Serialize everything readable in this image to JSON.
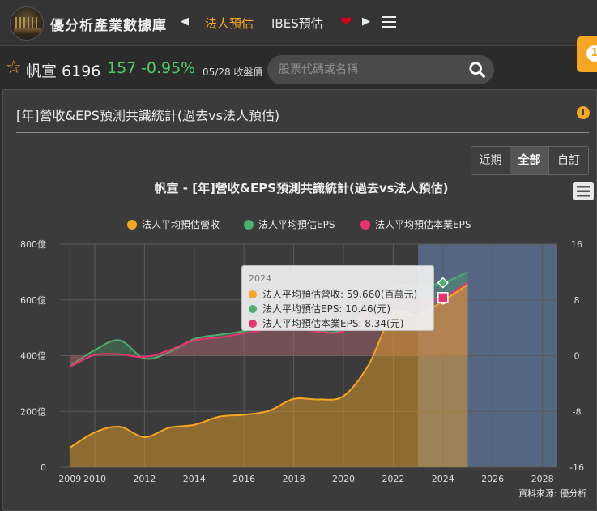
{
  "header": {
    "site_title": "優分析產業數據庫",
    "tabs": [
      {
        "label": "法人預估",
        "active": true
      },
      {
        "label": "IBES預估",
        "active": false
      }
    ],
    "badge": "1"
  },
  "stock": {
    "name_code": "帆宣 6196",
    "price": "157",
    "change": "-0.95%",
    "date_label": "05/28 收盤價",
    "search_placeholder": "股票代碼或名稱"
  },
  "panel": {
    "title": "[年]營收&EPS預測共識統計(過去vs法人預估)",
    "info": "i",
    "range_buttons": [
      {
        "label": "近期",
        "active": false
      },
      {
        "label": "全部",
        "active": true
      },
      {
        "label": "自訂",
        "active": false
      }
    ]
  },
  "colors": {
    "revenue": "#f5a623",
    "eps": "#4caf6e",
    "core_eps": "#e8336f",
    "accent": "#f5a623",
    "forecast_band": "#5a6e8f"
  },
  "chart_data": {
    "type": "area",
    "title": "帆宣 - [年]營收&EPS預測共識統計(過去vs法人預估)",
    "legend_position": "top",
    "x_ticks": [
      "2009",
      "2010",
      "2012",
      "2014",
      "2016",
      "2018",
      "2020",
      "2022",
      "2024",
      "2026",
      "2028"
    ],
    "y_left": {
      "ticks": [
        "800億",
        "600億",
        "400億",
        "200億",
        "0"
      ],
      "range": [
        0,
        80000
      ]
    },
    "y_right": {
      "ticks": [
        "16",
        "8",
        "0",
        "-8",
        "-16"
      ],
      "range": [
        -16,
        16
      ]
    },
    "forecast_from": 2023,
    "series": [
      {
        "name": "法人平均預估營收",
        "axis": "left",
        "unit": "百萬元",
        "x": [
          2009,
          2010,
          2011,
          2012,
          2013,
          2014,
          2015,
          2016,
          2017,
          2018,
          2019,
          2020,
          2021,
          2022,
          2023,
          2024,
          2025
        ],
        "values": [
          7000,
          12500,
          14500,
          10800,
          14200,
          15200,
          18100,
          18800,
          20200,
          24500,
          24300,
          25500,
          36500,
          55000,
          54500,
          59660,
          65500
        ]
      },
      {
        "name": "法人平均預估EPS",
        "axis": "right",
        "unit": "元",
        "x": [
          2009,
          2010,
          2011,
          2012,
          2013,
          2014,
          2015,
          2016,
          2017,
          2018,
          2019,
          2020,
          2021,
          2022,
          2023,
          2024,
          2025
        ],
        "values": [
          -1.5,
          0.8,
          2.2,
          -0.4,
          0.5,
          2.4,
          3.0,
          3.5,
          4.2,
          4.6,
          3.5,
          3.7,
          6.5,
          9.8,
          10.0,
          10.46,
          12.0
        ]
      },
      {
        "name": "法人平均預估本業EPS",
        "axis": "right",
        "unit": "元",
        "x": [
          2009,
          2010,
          2011,
          2012,
          2013,
          2014,
          2015,
          2016,
          2017,
          2018,
          2019,
          2020,
          2021,
          2022,
          2023,
          2024,
          2025
        ],
        "values": [
          -1.6,
          0.1,
          0.2,
          -0.2,
          0.8,
          2.2,
          2.6,
          3.2,
          3.8,
          4.1,
          3.4,
          3.5,
          6.2,
          8.6,
          7.8,
          8.34,
          10.5
        ]
      }
    ],
    "tooltip": {
      "title": "2024",
      "rows": [
        "法人平均預估營收: 59,660(百萬元)",
        "法人平均預估EPS: 10.46(元)",
        "法人平均預估本業EPS: 8.34(元)"
      ]
    },
    "source": "資料來源: 優分析"
  }
}
